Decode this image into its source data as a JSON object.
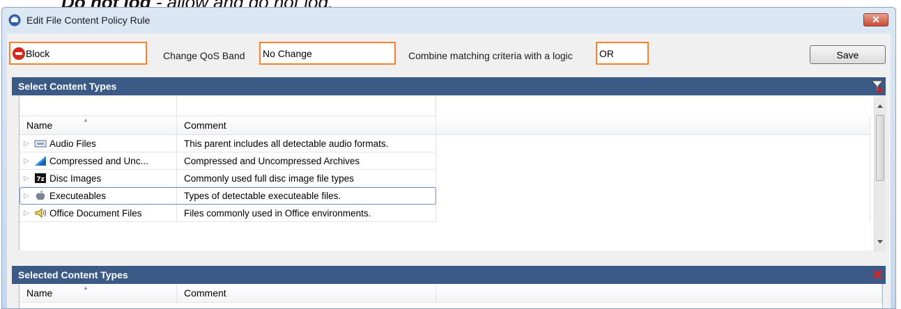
{
  "doc_text": {
    "bold": "Do not log",
    "rest": " - allow and do not log."
  },
  "window": {
    "title": "Edit File Content Policy Rule",
    "close_glyph": "✕"
  },
  "toolbar": {
    "action_value": "Block",
    "qos_label": "Change QoS Band",
    "qos_value": "No Change",
    "logic_label": "Combine matching criteria with a logic",
    "logic_value": "OR",
    "save_label": "Save"
  },
  "select_section": {
    "title": "Select Content Types",
    "columns": {
      "name": "Name",
      "comment": "Comment"
    },
    "rows": [
      {
        "name": "Audio Files",
        "comment": "This parent includes all detectable audio formats.",
        "icon": "audio-file-icon"
      },
      {
        "name": "Compressed and Unc...",
        "comment": "Compressed and Uncompressed Archives",
        "icon": "archive-icon"
      },
      {
        "name": "Disc Images",
        "comment": "Commonly used full disc image file types",
        "icon": "disc-image-icon"
      },
      {
        "name": "Executeables",
        "comment": "Types of detectable executeable files.",
        "icon": "apple-icon"
      },
      {
        "name": "Office Document Files",
        "comment": "Files commonly used in Office environments.",
        "icon": "speaker-icon"
      }
    ]
  },
  "selected_section": {
    "title": "Selected Content Types",
    "columns": {
      "name": "Name",
      "comment": "Comment"
    }
  },
  "colors": {
    "section_bar": "#3c5a86",
    "highlight_border": "#ff7f27",
    "block_red": "#d9261c"
  }
}
